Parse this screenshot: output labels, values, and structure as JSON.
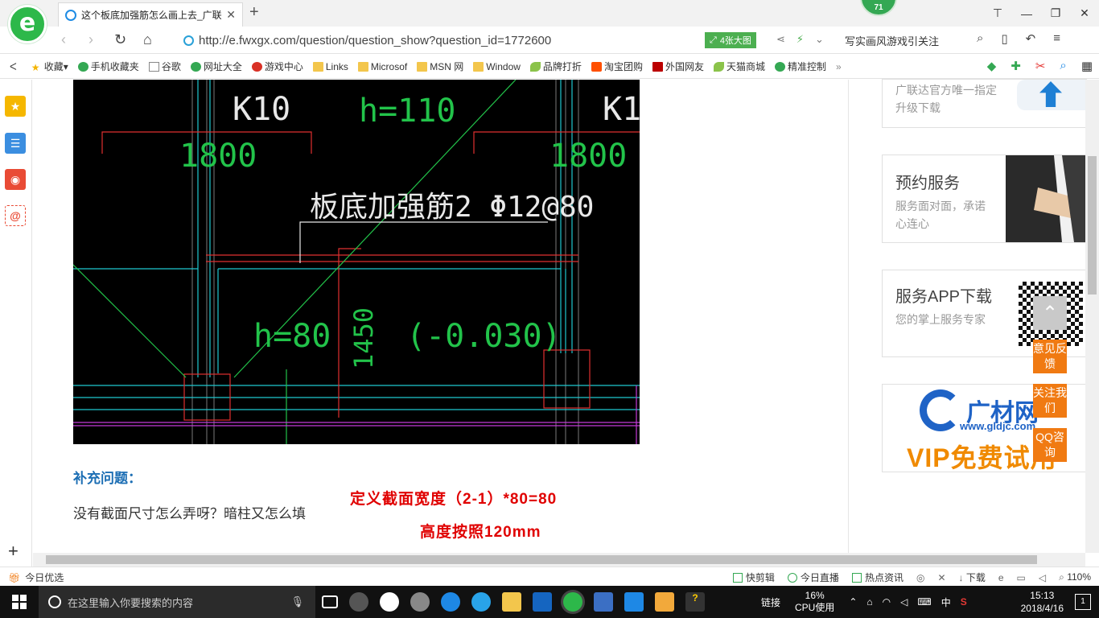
{
  "browser": {
    "tab_title": "这个板底加强筋怎么画上去_广联",
    "badge_count": "71",
    "url": "http://e.fwxgx.com/question/question_show?question_id=1772600",
    "big_pic_label": "4张大图",
    "search_text": "写实画风游戏引关注"
  },
  "bookmarks": [
    {
      "label": "收藏",
      "icon": "star-icon"
    },
    {
      "label": "手机收藏夹",
      "icon": "phone-icon"
    },
    {
      "label": "谷歌",
      "icon": "doc-icon"
    },
    {
      "label": "网址大全",
      "icon": "globe-icon"
    },
    {
      "label": "游戏中心",
      "icon": "game-icon"
    },
    {
      "label": "Links",
      "icon": "folder-icon"
    },
    {
      "label": "Microsof",
      "icon": "folder-icon"
    },
    {
      "label": "MSN 网",
      "icon": "folder-icon"
    },
    {
      "label": "Window",
      "icon": "folder-icon"
    },
    {
      "label": "品牌打折",
      "icon": "leaf-icon"
    },
    {
      "label": "淘宝团购",
      "icon": "taobao-icon"
    },
    {
      "label": "外国网友",
      "icon": "red-icon"
    },
    {
      "label": "天猫商城",
      "icon": "leaf-icon"
    },
    {
      "label": "精准控制",
      "icon": "chat-icon"
    }
  ],
  "cad": {
    "label_k10_left": "K10",
    "label_h110": "h=110",
    "label_k10_right": "K1",
    "label_1800_left": "1800",
    "label_1800_right": "1800",
    "label_rebar": "板底加强筋2 Φ12@80",
    "label_h80": "h=80",
    "label_1450": "1450",
    "label_elev": "(-0.030)"
  },
  "content": {
    "supplement_title": "补充问题：",
    "supplement_text": "没有截面尺寸怎么弄呀？暗柱又怎么填",
    "annotation_line1": "定义截面宽度（2-1）*80=80",
    "annotation_line2": "高度按照120mm"
  },
  "sidebar_cards": {
    "card1_sub": "广联达官方唯一指定升级下载",
    "card2_title": "预约服务",
    "card2_sub": "服务面对面，承诺心连心",
    "card3_title": "服务APP下载",
    "card3_sub": "您的掌上服务专家",
    "card4_brand": "广材网",
    "card4_url": "www.gldjc.com",
    "card4_vip": "VIP免费试用"
  },
  "float_widgets": {
    "feedback": "意见反馈",
    "follow": "关注我们",
    "qq": "QQ咨询"
  },
  "statusbar": {
    "left_label": "今日优选",
    "items": [
      "快剪辑",
      "今日直播",
      "热点资讯",
      "下载"
    ],
    "zoom": "110%"
  },
  "taskbar": {
    "search_placeholder": "在这里输入你要搜索的内容",
    "link_label": "链接",
    "cpu_percent": "16%",
    "cpu_label": "CPU使用",
    "ime": "中",
    "time": "15:13",
    "date": "2018/4/16",
    "notification_count": "1"
  },
  "colors": {
    "accent_green": "#2db84a",
    "link_blue": "#1c6eb4",
    "annotation_red": "#e00000",
    "widget_orange": "#f07a12"
  }
}
